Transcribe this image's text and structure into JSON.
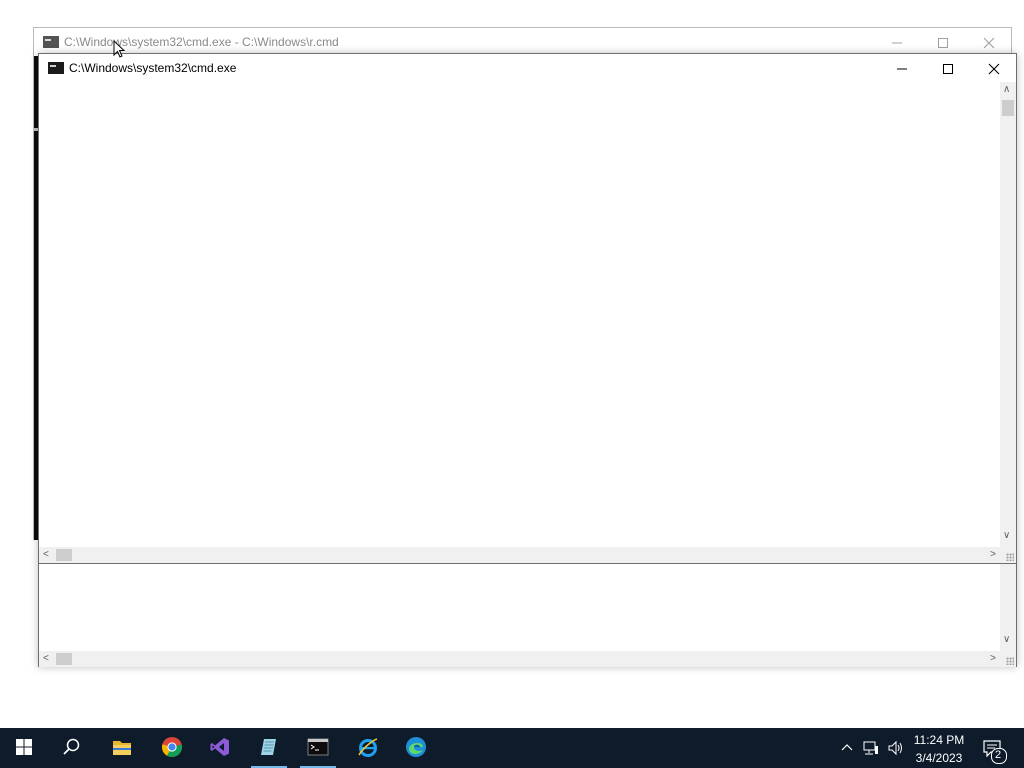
{
  "back_window": {
    "title": "C:\\Windows\\system32\\cmd.exe - C:\\Windows\\r.cmd"
  },
  "front_window": {
    "title": "C:\\Windows\\system32\\cmd.exe"
  },
  "taskbar": {
    "apps": [
      {
        "name": "start",
        "icon": "windows-logo-icon"
      },
      {
        "name": "search",
        "icon": "search-icon"
      },
      {
        "name": "file-explorer",
        "icon": "folder-icon"
      },
      {
        "name": "chrome",
        "icon": "chrome-icon"
      },
      {
        "name": "visual-studio",
        "icon": "visual-studio-icon"
      },
      {
        "name": "notepad",
        "icon": "notepad-icon"
      },
      {
        "name": "command-prompt",
        "icon": "cmd-icon"
      },
      {
        "name": "internet-explorer",
        "icon": "ie-icon"
      },
      {
        "name": "edge",
        "icon": "edge-icon"
      }
    ],
    "clock": {
      "time": "11:24 PM",
      "date": "3/4/2023"
    },
    "notifications_count": "2"
  },
  "colors": {
    "taskbar_bg": "#0d1b2a",
    "taskbar_accent": "#76b9ed",
    "console_bg": "#0c0c0c"
  }
}
